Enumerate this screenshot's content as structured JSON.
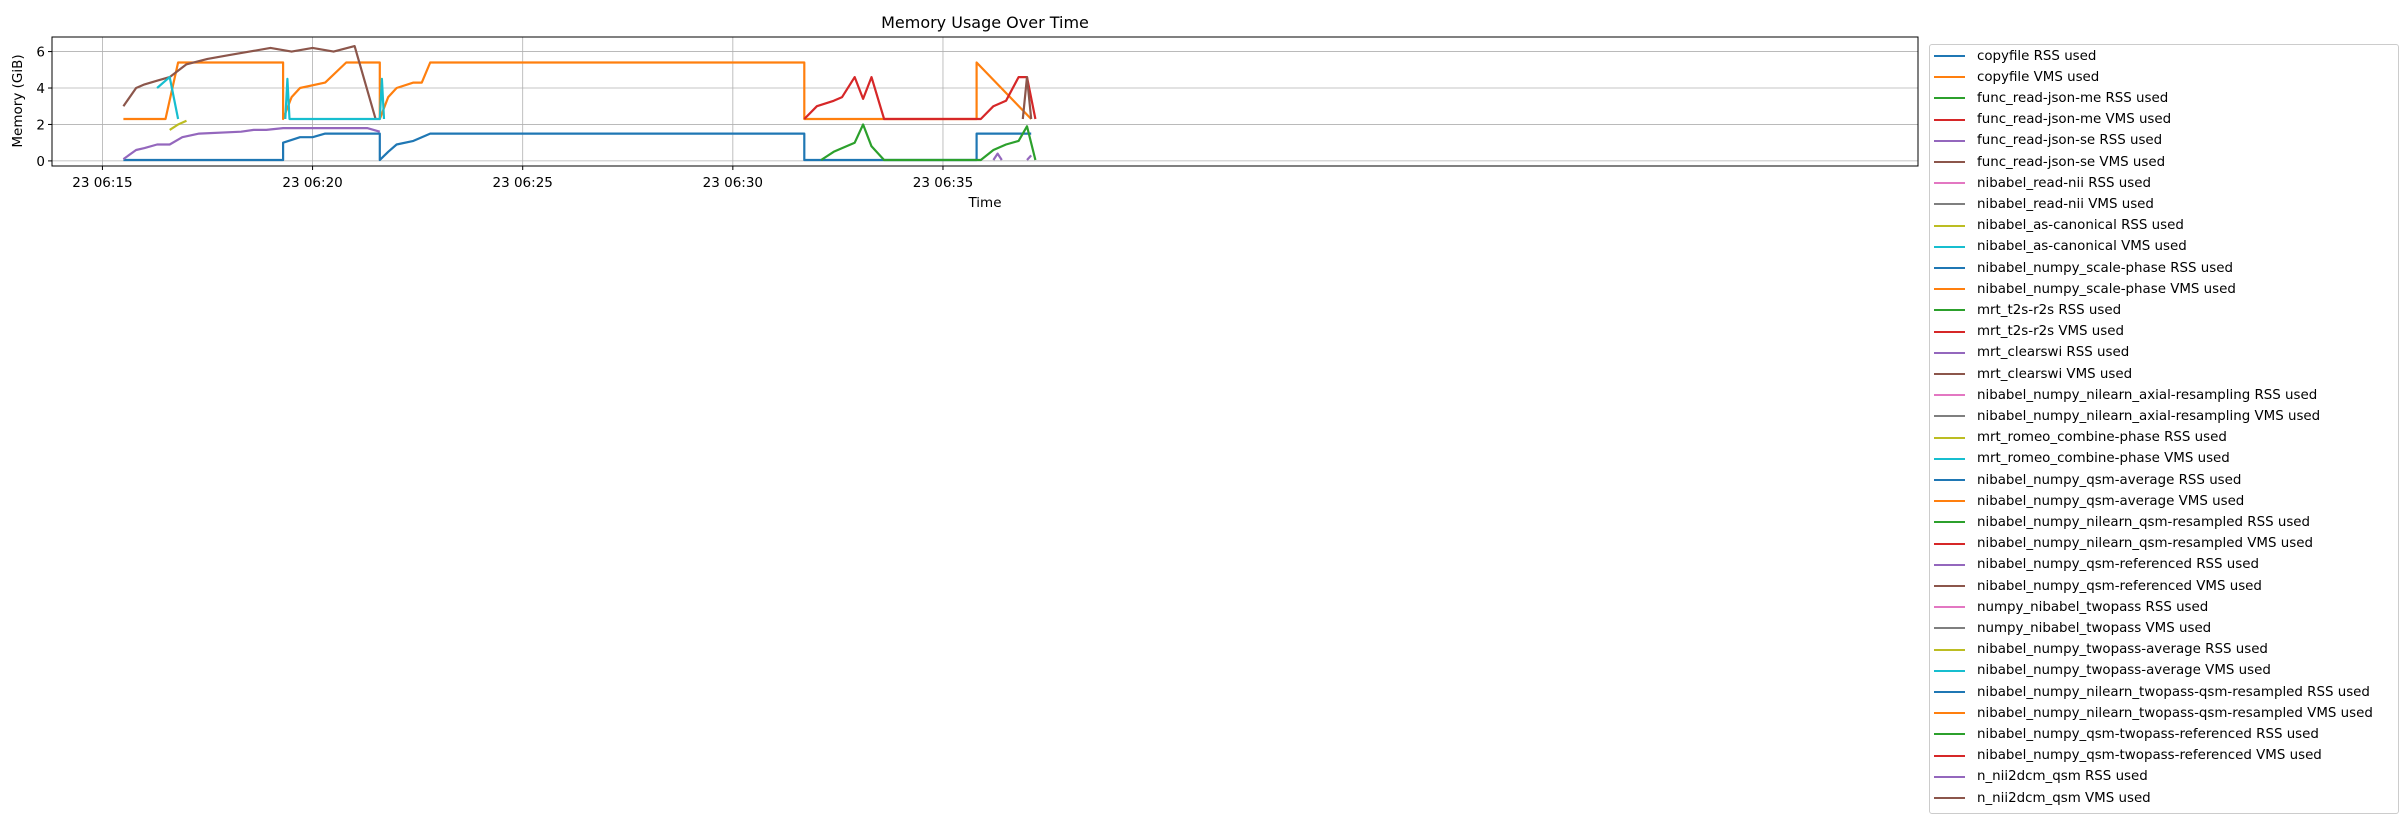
{
  "chart_data": {
    "type": "line",
    "title": "Memory Usage Over Time",
    "xlabel": "Time",
    "ylabel": "Memory (GiB)",
    "x_unit": "minutes after 23 06:15",
    "xlim": [
      -1.2,
      43.2
    ],
    "ylim": [
      -0.28,
      6.8
    ],
    "x_ticks": [
      {
        "value": 0,
        "label": "23 06:15"
      },
      {
        "value": 5,
        "label": "23 06:20"
      },
      {
        "value": 10,
        "label": "23 06:25"
      },
      {
        "value": 15,
        "label": "23 06:30"
      },
      {
        "value": 20,
        "label": "23 06:35"
      }
    ],
    "y_ticks": [
      0,
      2,
      4,
      6
    ],
    "grid": true,
    "legend_position": "outside-right",
    "series": [
      {
        "name": "copyfile RSS used",
        "color": "#1f77b4",
        "x": [
          0.5,
          1.5,
          1.5,
          4.3,
          4.3,
          4.5,
          4.7,
          5.0,
          5.3,
          5.8,
          6.6,
          6.6,
          6.8,
          7.0,
          7.4,
          7.6,
          7.8,
          16.7,
          16.7,
          20.8,
          20.8,
          22.1
        ],
        "y": [
          0.05,
          0.05,
          0.05,
          0.05,
          1.0,
          1.15,
          1.3,
          1.3,
          1.5,
          1.5,
          1.5,
          0.05,
          0.5,
          0.9,
          1.1,
          1.3,
          1.5,
          1.5,
          0.05,
          0.05,
          1.5,
          1.5
        ]
      },
      {
        "name": "copyfile VMS used",
        "color": "#ff7f0e",
        "x": [
          0.5,
          1.5,
          1.5,
          1.8,
          4.3,
          4.3,
          4.5,
          4.7,
          5.3,
          5.8,
          6.6,
          6.6,
          6.8,
          7.0,
          7.4,
          7.6,
          7.8,
          16.7,
          16.7,
          20.8,
          20.8,
          22.1
        ],
        "y": [
          2.3,
          2.3,
          2.3,
          5.4,
          5.4,
          2.3,
          3.5,
          4.0,
          4.3,
          5.4,
          5.4,
          2.3,
          3.5,
          4.0,
          4.3,
          4.3,
          5.4,
          5.4,
          2.3,
          2.3,
          5.4,
          2.3
        ]
      },
      {
        "name": "func_read-json-me RSS used",
        "color": "#2ca02c",
        "x": [
          17.1,
          17.4,
          17.6,
          17.9,
          18.1,
          18.3,
          18.6,
          20.9,
          21.2,
          21.5,
          21.8,
          22.0,
          22.2
        ],
        "y": [
          0.05,
          0.5,
          0.7,
          1.0,
          2.0,
          0.8,
          0.05,
          0.05,
          0.6,
          0.9,
          1.1,
          1.9,
          0.05
        ]
      },
      {
        "name": "func_read-json-me VMS used",
        "color": "#d62728",
        "x": [
          16.7,
          17.0,
          17.4,
          17.6,
          17.9,
          18.1,
          18.3,
          18.6,
          20.9,
          21.2,
          21.5,
          21.8,
          22.0,
          22.2
        ],
        "y": [
          2.3,
          3.0,
          3.3,
          3.5,
          4.6,
          3.4,
          4.6,
          2.3,
          2.3,
          3.0,
          3.3,
          4.6,
          4.6,
          2.3
        ]
      },
      {
        "name": "func_read-json-se RSS used",
        "color": "#9467bd",
        "x": [
          0.5,
          0.8,
          1.0,
          1.3,
          1.6,
          1.9,
          2.3,
          3.3,
          3.6,
          3.9,
          4.3,
          6.3,
          6.6
        ],
        "y": [
          0.1,
          0.6,
          0.7,
          0.9,
          0.9,
          1.3,
          1.5,
          1.6,
          1.7,
          1.7,
          1.8,
          1.8,
          1.6
        ]
      },
      {
        "name": "func_read-json-se VMS used",
        "color": "#8c564b",
        "x": [
          0.5,
          0.8,
          1.0,
          1.3,
          1.6,
          2.0,
          2.5,
          3.0,
          3.5,
          4.0,
          4.5,
          5.0,
          5.5,
          6.0,
          6.5
        ],
        "y": [
          3.0,
          4.0,
          4.2,
          4.4,
          4.6,
          5.3,
          5.6,
          5.8,
          6.0,
          6.2,
          6.0,
          6.2,
          6.0,
          6.3,
          2.3
        ]
      },
      {
        "name": "nibabel_read-nii RSS used",
        "color": "#e377c2",
        "x": [],
        "y": []
      },
      {
        "name": "nibabel_read-nii VMS used",
        "color": "#7f7f7f",
        "x": [],
        "y": []
      },
      {
        "name": "nibabel_as-canonical RSS used",
        "color": "#bcbd22",
        "x": [
          1.6,
          1.8,
          2.0
        ],
        "y": [
          1.7,
          2.0,
          2.2
        ]
      },
      {
        "name": "nibabel_as-canonical VMS used",
        "color": "#17becf",
        "x": [
          1.3,
          1.5,
          1.6,
          1.8
        ],
        "y": [
          4.0,
          4.4,
          4.6,
          2.3
        ]
      },
      {
        "name": "nibabel_numpy_scale-phase RSS used",
        "color": "#1f77b4",
        "x": [],
        "y": []
      },
      {
        "name": "nibabel_numpy_scale-phase VMS used",
        "color": "#ff7f0e",
        "x": [],
        "y": []
      },
      {
        "name": "mrt_t2s-r2s RSS used",
        "color": "#2ca02c",
        "x": [],
        "y": []
      },
      {
        "name": "mrt_t2s-r2s VMS used",
        "color": "#d62728",
        "x": [],
        "y": []
      },
      {
        "name": "mrt_clearswi RSS used",
        "color": "#9467bd",
        "x": [],
        "y": []
      },
      {
        "name": "mrt_clearswi VMS used",
        "color": "#8c564b",
        "x": [],
        "y": []
      },
      {
        "name": "nibabel_numpy_nilearn_axial-resampling RSS used",
        "color": "#e377c2",
        "x": [],
        "y": []
      },
      {
        "name": "nibabel_numpy_nilearn_axial-resampling VMS used",
        "color": "#7f7f7f",
        "x": [],
        "y": []
      },
      {
        "name": "mrt_romeo_combine-phase RSS used",
        "color": "#bcbd22",
        "x": [],
        "y": []
      },
      {
        "name": "mrt_romeo_combine-phase VMS used",
        "color": "#17becf",
        "x": [
          4.35,
          4.4,
          4.45,
          6.6,
          6.65,
          6.7
        ],
        "y": [
          2.3,
          4.5,
          2.3,
          2.3,
          4.5,
          2.3
        ]
      },
      {
        "name": "nibabel_numpy_qsm-average RSS used",
        "color": "#1f77b4",
        "x": [],
        "y": []
      },
      {
        "name": "nibabel_numpy_qsm-average VMS used",
        "color": "#ff7f0e",
        "x": [],
        "y": []
      },
      {
        "name": "nibabel_numpy_nilearn_qsm-resampled RSS used",
        "color": "#2ca02c",
        "x": [],
        "y": []
      },
      {
        "name": "nibabel_numpy_nilearn_qsm-resampled VMS used",
        "color": "#d62728",
        "x": [],
        "y": []
      },
      {
        "name": "nibabel_numpy_qsm-referenced RSS used",
        "color": "#9467bd",
        "x": [
          22.0,
          22.1
        ],
        "y": [
          0.05,
          0.3
        ]
      },
      {
        "name": "nibabel_numpy_qsm-referenced VMS used",
        "color": "#8c564b",
        "x": [
          21.9,
          22.0,
          22.1
        ],
        "y": [
          2.3,
          4.6,
          2.3
        ]
      },
      {
        "name": "numpy_nibabel_twopass RSS used",
        "color": "#e377c2",
        "x": [],
        "y": []
      },
      {
        "name": "numpy_nibabel_twopass VMS used",
        "color": "#7f7f7f",
        "x": [],
        "y": []
      },
      {
        "name": "nibabel_numpy_twopass-average RSS used",
        "color": "#bcbd22",
        "x": [],
        "y": []
      },
      {
        "name": "nibabel_numpy_twopass-average VMS used",
        "color": "#17becf",
        "x": [],
        "y": []
      },
      {
        "name": "nibabel_numpy_nilearn_twopass-qsm-resampled RSS used",
        "color": "#1f77b4",
        "x": [],
        "y": []
      },
      {
        "name": "nibabel_numpy_nilearn_twopass-qsm-resampled VMS used",
        "color": "#ff7f0e",
        "x": [],
        "y": []
      },
      {
        "name": "nibabel_numpy_qsm-twopass-referenced RSS used",
        "color": "#2ca02c",
        "x": [],
        "y": []
      },
      {
        "name": "nibabel_numpy_qsm-twopass-referenced VMS used",
        "color": "#d62728",
        "x": [],
        "y": []
      },
      {
        "name": "n_nii2dcm_qsm RSS used",
        "color": "#9467bd",
        "x": [
          21.2,
          21.3,
          21.4
        ],
        "y": [
          0.05,
          0.4,
          0.05
        ]
      },
      {
        "name": "n_nii2dcm_qsm VMS used",
        "color": "#8c564b",
        "x": [],
        "y": []
      }
    ]
  }
}
